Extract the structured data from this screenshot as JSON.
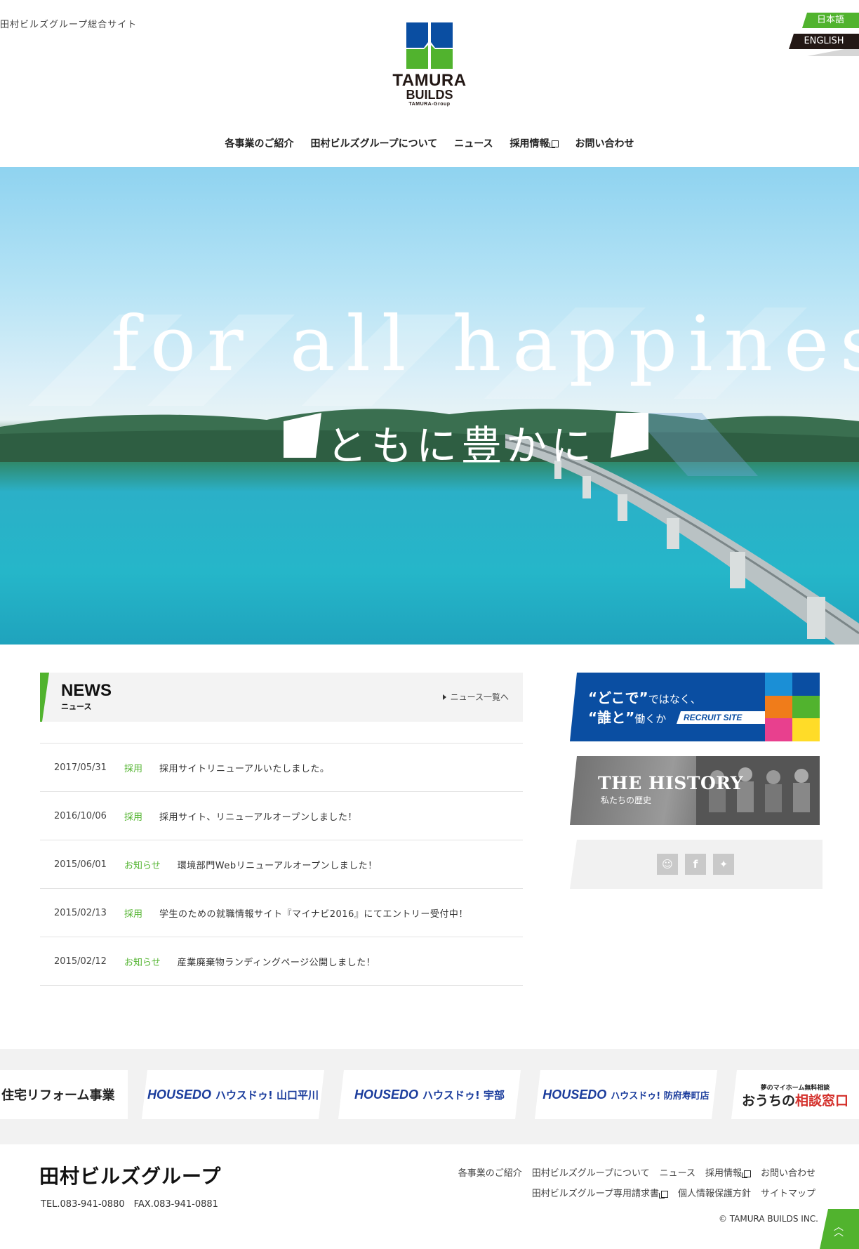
{
  "header": {
    "site_tag": "田村ビルズグループ総合サイト",
    "logo_line1": "TAMURA",
    "logo_line2": "BUILDS",
    "logo_line3": "TAMURA-Group",
    "lang_ja": "日本語",
    "lang_en": "ENGLISH"
  },
  "nav": {
    "items": [
      "各事業のご紹介",
      "田村ビルズグループについて",
      "ニュース",
      "採用情報",
      "お問い合わせ"
    ]
  },
  "hero": {
    "title": "for all happiness",
    "subtitle": "ともに豊かに"
  },
  "news": {
    "title": "NEWS",
    "title_ja": "ニュース",
    "more": "ニュース一覧へ",
    "items": [
      {
        "date": "2017/05/31",
        "category": "採用",
        "text": "採用サイトリニューアルいたしました。"
      },
      {
        "date": "2016/10/06",
        "category": "採用",
        "text": "採用サイト、リニューアルオープンしました！"
      },
      {
        "date": "2015/06/01",
        "category": "お知らせ",
        "text": "環境部門Webリニューアルオープンしました！"
      },
      {
        "date": "2015/02/13",
        "category": "採用",
        "text": "学生のための就職情報サイト『マイナビ2016』にてエントリー受付中！"
      },
      {
        "date": "2015/02/12",
        "category": "お知らせ",
        "text": "産業廃棄物ランディングページ公開しました！"
      }
    ]
  },
  "sidebar": {
    "recruit_line1_big": "“どこで”",
    "recruit_line1_small": "ではなく、",
    "recruit_line2_big": "“誰と”",
    "recruit_line2_small": "働くか",
    "recruit_site": "RECRUIT SITE",
    "history_title": "THE HISTORY",
    "history_sub": "私たちの歴史",
    "sns": [
      "blog-icon",
      "facebook-icon",
      "twitter-icon"
    ]
  },
  "banners": {
    "reform": "住宅リフォーム事業",
    "hd_logo": "HOUSE",
    "hd_logo2": "DO",
    "hd1": "ハウスドゥ! 山口平川",
    "hd2": "ハウスドゥ! 宇部",
    "hd3": "ハウスドゥ! 防府寿町店",
    "ouchi_small": "夢のマイホーム無料相談",
    "ouchi_prefix": "おうちの",
    "ouchi_emph": "相談窓口"
  },
  "footer": {
    "logo": "田村ビルズグループ",
    "tel": "TEL.083-941-0880　FAX.083-941-0881",
    "nav1": [
      "各事業のご紹介",
      "田村ビルズグループについて",
      "ニュース",
      "採用情報",
      "お問い合わせ"
    ],
    "nav2": [
      "田村ビルズグループ専用請求書",
      "個人情報保護方針",
      "サイトマップ"
    ],
    "copyright": "© TAMURA BUILDS INC."
  },
  "colors": {
    "accent_green": "#51b32e",
    "brand_blue": "#0a4ea2",
    "dark": "#231815"
  }
}
